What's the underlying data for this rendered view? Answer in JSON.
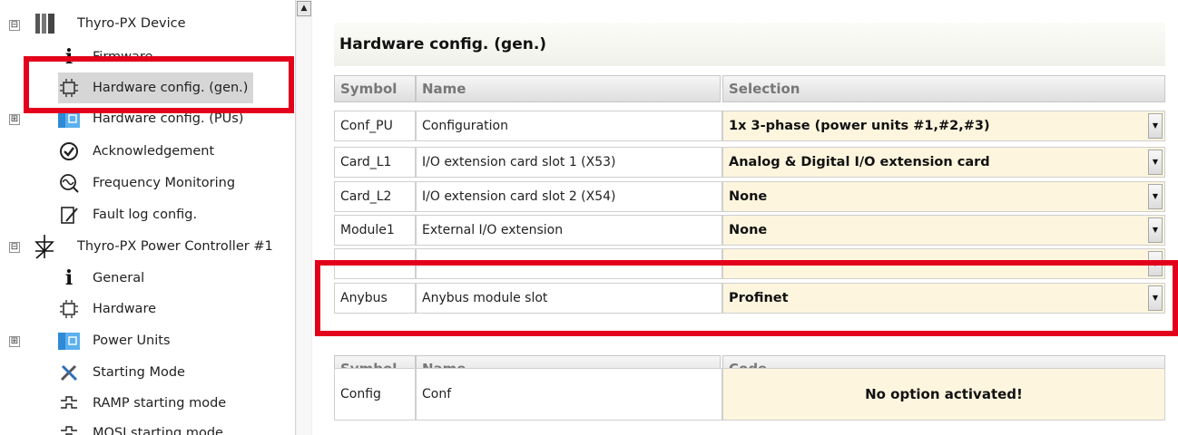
{
  "tree": {
    "items": [
      {
        "label": "Thyro-PX Device",
        "icon": "device-rack-icon",
        "expander": "⊟"
      },
      {
        "label": "Firmware",
        "icon": "info-icon"
      },
      {
        "label": "Hardware config. (gen.)",
        "icon": "chip-icon"
      },
      {
        "label": "Hardware config. (PUs)",
        "icon": "power-units-icon",
        "expander": "⊞"
      },
      {
        "label": "Acknowledgement",
        "icon": "check-circle-icon"
      },
      {
        "label": "Frequency Monitoring",
        "icon": "frequency-icon"
      },
      {
        "label": "Fault log config.",
        "icon": "fault-log-icon"
      },
      {
        "label": "Thyro-PX Power Controller #1",
        "icon": "thyristor-icon",
        "expander": "⊟"
      },
      {
        "label": "General",
        "icon": "info-icon"
      },
      {
        "label": "Hardware",
        "icon": "chip-icon"
      },
      {
        "label": "Power Units",
        "icon": "power-units-icon",
        "expander": "⊞"
      },
      {
        "label": "Starting Mode",
        "icon": "tools-icon"
      },
      {
        "label": "RAMP starting mode",
        "icon": "ramp-icon"
      },
      {
        "label": "MOSI starting mode",
        "icon": "ramp-icon"
      }
    ]
  },
  "page": {
    "title": "Hardware config. (gen.)"
  },
  "table1": {
    "headers": [
      "Symbol",
      "Name",
      "Selection"
    ],
    "rows": [
      {
        "symbol": "Conf_PU",
        "name": "Configuration",
        "selection": "1x 3-phase (power units #1,#2,#3)"
      },
      {
        "symbol": "Card_L1",
        "name": "I/O extension card slot 1 (X53)",
        "selection": "Analog & Digital I/O extension card"
      },
      {
        "symbol": "Card_L2",
        "name": "I/O extension card slot 2 (X54)",
        "selection": "None"
      },
      {
        "symbol": "Module1",
        "name": "External I/O extension",
        "selection": "None"
      },
      {
        "symbol": "Anybus",
        "name": "Anybus module slot",
        "selection": "Profinet"
      }
    ]
  },
  "table2": {
    "headers": [
      "Symbol",
      "Name",
      "Code"
    ],
    "rows": [
      {
        "symbol": "Config",
        "name": "Conf",
        "code": "No option activated!"
      }
    ]
  },
  "colors": {
    "highlight": "#e3001b",
    "selection_bg": "#fdf5de",
    "tree_selected": "#d6d6d6"
  }
}
